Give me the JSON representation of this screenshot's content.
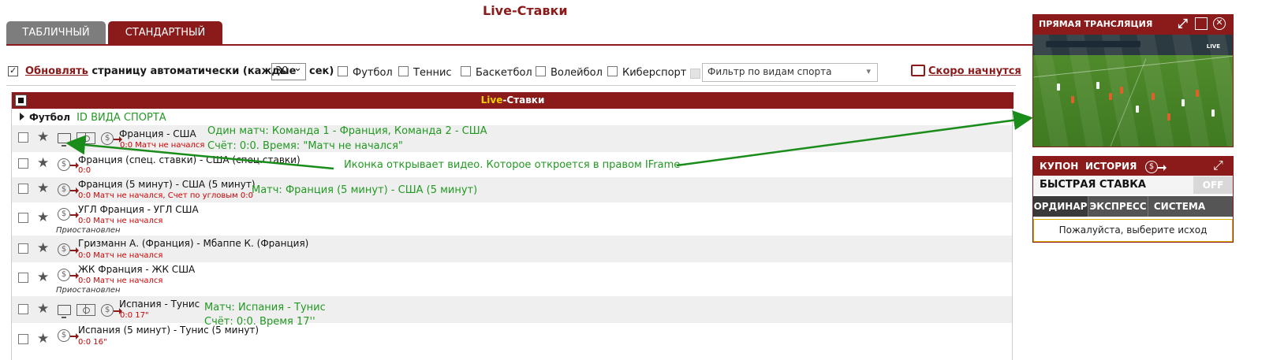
{
  "page": {
    "title": "Live-Ставки"
  },
  "tabs": [
    {
      "label": "ТАБЛИЧНЫЙ",
      "active": false
    },
    {
      "label": "СТАНДАРТНЫЙ",
      "active": true
    }
  ],
  "controls": {
    "refresh_link": "Обновлять",
    "refresh_rest": " страницу автоматически (каждые",
    "interval_value": "30",
    "interval_unit": "сек)",
    "sports": [
      "Футбол",
      "Теннис",
      "Баскетбол",
      "Волейбол",
      "Киберспорт"
    ],
    "filter_placeholder": "Фильтр по видам спорта",
    "soon_label": "Скоро начнутся"
  },
  "table": {
    "header_live": "Live",
    "header_rest": "-Ставки",
    "sport_name": "Футбол",
    "sport_note": "ID ВИДА СПОРТА",
    "rows": [
      {
        "match": "Франция - США",
        "status": "0:0 Матч не начался",
        "paused": ""
      },
      {
        "match": "Франция (спец. ставки) - США (спец.ставки)",
        "status": "0:0",
        "paused": ""
      },
      {
        "match": "Франция (5 минут) - США (5 минут)",
        "status": "0:0 Матч не начался, Счет по угловым 0:0",
        "paused": ""
      },
      {
        "match": "УГЛ Франция - УГЛ США",
        "status": "0:0 Матч не начался",
        "paused": "Приостановлен"
      },
      {
        "match": "Гризманн А. (Франция) - Мбаппе К. (Франция)",
        "status": "0:0 Матч не начался",
        "paused": ""
      },
      {
        "match": "ЖК Франция - ЖК США",
        "status": "0:0 Матч не начался",
        "paused": "Приостановлен"
      },
      {
        "match": "Испания - Тунис",
        "status": "0:0 17\"",
        "paused": ""
      },
      {
        "match": "Испания (5 минут) - Тунис (5 минут)",
        "status": "0:0 16\"",
        "paused": ""
      }
    ]
  },
  "annotations": {
    "a1_line1": "Один матч: Команда 1 - Франция, Команда 2 - США",
    "a1_line2": "Счёт: 0:0. Время: \"Матч не начался\"",
    "a2": "Иконка открывает видео. Которое откроется в правом IFrame",
    "a3": "Матч: Франция (5 минут) - США (5 минут)",
    "a4_line1": "Матч: Испания - Тунис",
    "a4_line2": "Счёт: 0:0. Время 17''",
    "color": "#229922"
  },
  "stream": {
    "title": "ПРЯМАЯ ТРАНСЛЯЦИЯ",
    "live_tag": "LIVE"
  },
  "coupon": {
    "tab_coupon": "КУПОН",
    "tab_history": "ИСТОРИЯ",
    "fast_bet": "БЫСТРАЯ СТАВКА",
    "toggle": "OFF",
    "modes": [
      "ОРДИНАР",
      "ЭКСПРЕСС",
      "СИСТЕМА"
    ],
    "prompt": "Пожалуйста, выберите исход"
  },
  "colors": {
    "brand": "#8b1a1a",
    "highlight": "#f0d000",
    "status_red": "#cc0000"
  }
}
